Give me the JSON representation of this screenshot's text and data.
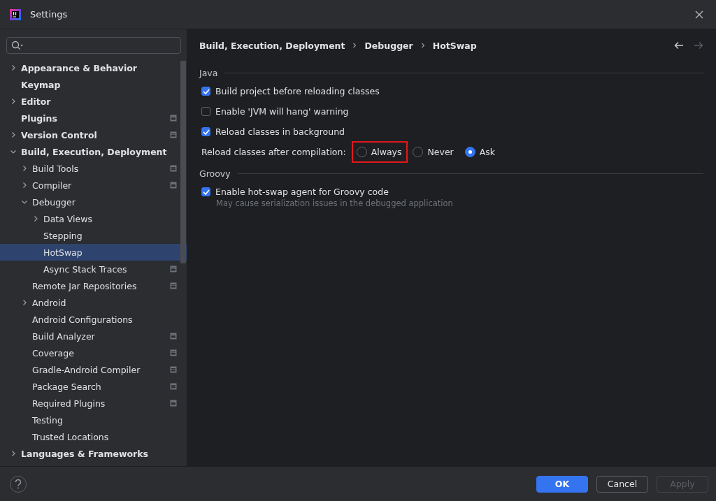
{
  "window": {
    "title": "Settings"
  },
  "sidebar": {
    "items": [
      {
        "label": "Appearance & Behavior",
        "expanded": false,
        "project_badge": false,
        "selected": false
      },
      {
        "label": "Keymap",
        "project_badge": false,
        "selected": false
      },
      {
        "label": "Editor",
        "expanded": false,
        "project_badge": false,
        "selected": false
      },
      {
        "label": "Plugins",
        "project_badge": true,
        "selected": false
      },
      {
        "label": "Version Control",
        "expanded": false,
        "project_badge": true,
        "selected": false
      },
      {
        "label": "Build, Execution, Deployment",
        "expanded": true,
        "project_badge": false,
        "selected": false,
        "children": [
          {
            "label": "Build Tools",
            "expanded": false,
            "project_badge": true,
            "selected": false
          },
          {
            "label": "Compiler",
            "expanded": false,
            "project_badge": true,
            "selected": false
          },
          {
            "label": "Debugger",
            "expanded": true,
            "project_badge": false,
            "selected": false,
            "children": [
              {
                "label": "Data Views",
                "expanded": false,
                "project_badge": false,
                "selected": false
              },
              {
                "label": "Stepping",
                "project_badge": false,
                "selected": false
              },
              {
                "label": "HotSwap",
                "project_badge": false,
                "selected": true
              },
              {
                "label": "Async Stack Traces",
                "project_badge": true,
                "selected": false
              }
            ]
          },
          {
            "label": "Remote Jar Repositories",
            "project_badge": true,
            "selected": false
          },
          {
            "label": "Android",
            "expanded": false,
            "project_badge": false,
            "selected": false
          },
          {
            "label": "Android Configurations",
            "project_badge": false,
            "selected": false
          },
          {
            "label": "Build Analyzer",
            "project_badge": true,
            "selected": false
          },
          {
            "label": "Coverage",
            "project_badge": true,
            "selected": false
          },
          {
            "label": "Gradle-Android Compiler",
            "project_badge": true,
            "selected": false
          },
          {
            "label": "Package Search",
            "project_badge": true,
            "selected": false
          },
          {
            "label": "Required Plugins",
            "project_badge": true,
            "selected": false
          },
          {
            "label": "Testing",
            "project_badge": false,
            "selected": false
          },
          {
            "label": "Trusted Locations",
            "project_badge": false,
            "selected": false
          }
        ]
      },
      {
        "label": "Languages & Frameworks",
        "expanded": false,
        "project_badge": false,
        "selected": false
      }
    ]
  },
  "breadcrumbs": [
    "Build, Execution, Deployment",
    "Debugger",
    "HotSwap"
  ],
  "sections": [
    {
      "title": "Java",
      "rows": [
        {
          "kind": "checkbox",
          "label": "Build project before reloading classes",
          "checked": true
        },
        {
          "kind": "checkbox",
          "label": "Enable 'JVM will hang' warning",
          "checked": false
        },
        {
          "kind": "checkbox",
          "label": "Reload classes in background",
          "checked": true
        },
        {
          "kind": "radio",
          "label": "Reload classes after compilation:",
          "options": [
            {
              "label": "Always",
              "selected": false,
              "highlighted": true
            },
            {
              "label": "Never",
              "selected": false,
              "highlighted": false
            },
            {
              "label": "Ask",
              "selected": true,
              "highlighted": false
            }
          ]
        }
      ]
    },
    {
      "title": "Groovy",
      "rows": [
        {
          "kind": "checkbox",
          "label": "Enable hot-swap agent for Groovy code",
          "checked": true,
          "hint": "May cause serialization issues in the debugged application"
        }
      ]
    }
  ],
  "buttons": [
    {
      "label": "OK",
      "kind": "primary"
    },
    {
      "label": "Cancel",
      "kind": "normal"
    },
    {
      "label": "Apply",
      "kind": "disabled"
    }
  ]
}
